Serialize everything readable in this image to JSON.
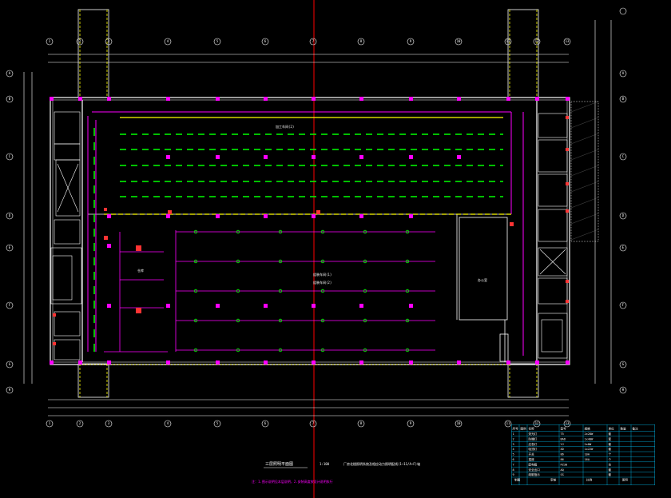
{
  "drawing": {
    "title": "三层照明平面图",
    "scale": "1:100",
    "subtitle": "厂房北楼照明系统及相应动力照明配线(1~11/A~F)轴",
    "note": "注：1.图示说明见本层说明，2.安装高度按设计说明执行"
  },
  "axes": {
    "top": [
      "1",
      "2",
      "3",
      "4",
      "5",
      "6",
      "7",
      "8",
      "9",
      "10",
      "11",
      "12",
      "13"
    ],
    "left": [
      "A",
      "B",
      "C",
      "D",
      "E",
      "F",
      "G",
      "H"
    ]
  },
  "room_labels": {
    "upper_hall": "加工车间(2)",
    "lower_hall_1": "组装车间(1)",
    "lower_hall_2": "组装车间(2)",
    "left_room": "仓库",
    "right_room": "办公室"
  },
  "legend": {
    "headers": [
      "序号",
      "图例",
      "名称",
      "型号",
      "规格",
      "单位",
      "数量",
      "备注"
    ],
    "rows": [
      [
        "1",
        "",
        "荧光灯",
        "T5",
        "2x28W",
        "套",
        "",
        ""
      ],
      [
        "2",
        "",
        "防爆灯",
        "BAD",
        "1x40W",
        "套",
        "",
        ""
      ],
      [
        "3",
        "",
        "应急灯",
        "YJ",
        "2x8W",
        "套",
        "",
        ""
      ],
      [
        "4",
        "",
        "吸顶灯",
        "XD",
        "1x22W",
        "套",
        "",
        ""
      ],
      [
        "5",
        "",
        "开关",
        "86",
        "10A",
        "个",
        "",
        ""
      ],
      [
        "6",
        "",
        "插座",
        "86",
        "16A",
        "个",
        "",
        ""
      ],
      [
        "7",
        "",
        "配电箱",
        "PZ30",
        "",
        "台",
        "",
        ""
      ],
      [
        "8",
        "",
        "安全出口",
        "AQ",
        "",
        "套",
        "",
        ""
      ],
      [
        "9",
        "",
        "疏散指示",
        "SS",
        "",
        "套",
        "",
        ""
      ]
    ],
    "footer": [
      "制图",
      "审核",
      "比例",
      "图号"
    ]
  },
  "colors": {
    "wall": "#ffffff",
    "circuit": "#ff00ff",
    "lighting": "#00ff00",
    "emergency": "#ffff00",
    "axis_line": "#ff0000",
    "legend_line": "#00c8ff"
  }
}
